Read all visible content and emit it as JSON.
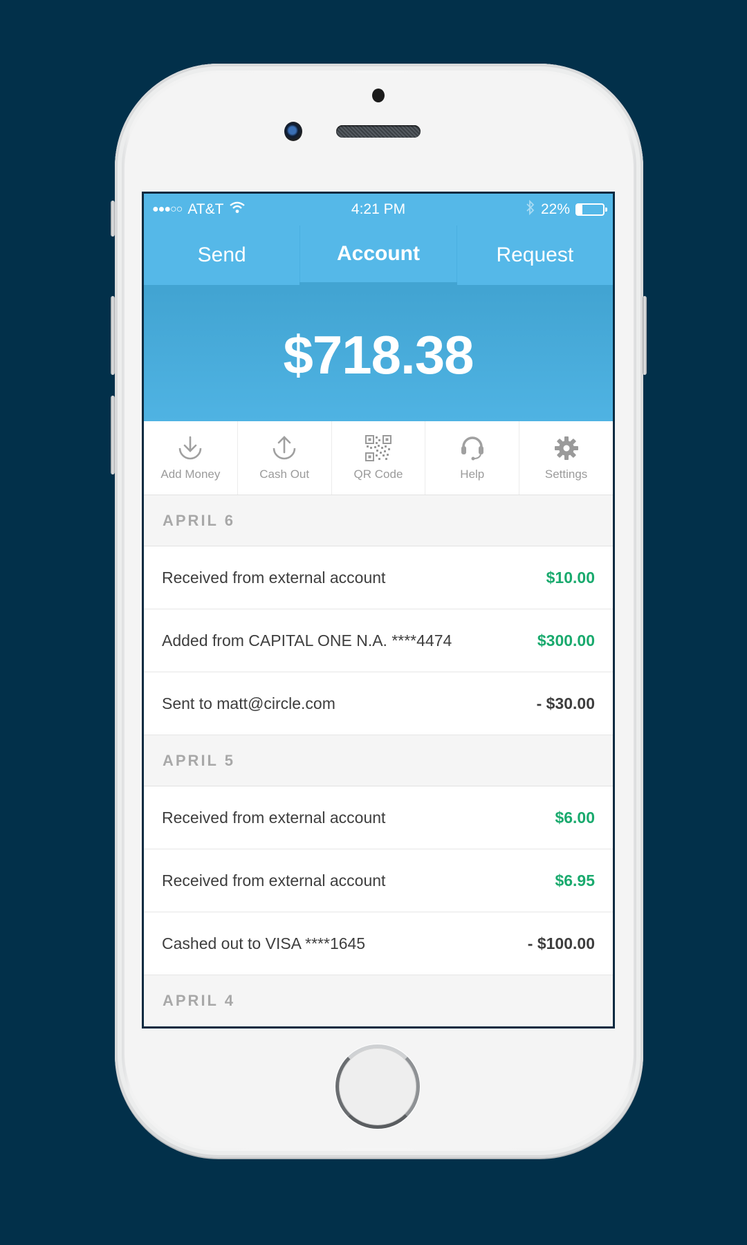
{
  "status_bar": {
    "signal": "●●●○○",
    "carrier": "AT&T",
    "wifi_icon": "wifi-icon",
    "time": "4:21 PM",
    "bluetooth_icon": "bluetooth-icon",
    "battery_percent": "22%",
    "battery_level": 0.22
  },
  "tabs": [
    {
      "label": "Send",
      "active": false
    },
    {
      "label": "Account",
      "active": true
    },
    {
      "label": "Request",
      "active": false
    }
  ],
  "balance": "$718.38",
  "actions": [
    {
      "label": "Add Money",
      "icon": "download-icon"
    },
    {
      "label": "Cash Out",
      "icon": "upload-icon"
    },
    {
      "label": "QR Code",
      "icon": "qr-code-icon"
    },
    {
      "label": "Help",
      "icon": "headset-icon"
    },
    {
      "label": "Settings",
      "icon": "gear-icon"
    }
  ],
  "colors": {
    "primary": "#55b8e8",
    "balance_bg": "#42a4d2",
    "credit": "#1aaa6e",
    "debit": "#3e3e3e",
    "background": "#02304a"
  },
  "groups": [
    {
      "date": "APRIL 6",
      "transactions": [
        {
          "description": "Received from external account",
          "amount": "$10.00",
          "type": "credit"
        },
        {
          "description": "Added from CAPITAL ONE N.A. ****4474",
          "amount": "$300.00",
          "type": "credit"
        },
        {
          "description": "Sent to matt@circle.com",
          "amount": "- $30.00",
          "type": "debit"
        }
      ]
    },
    {
      "date": "APRIL 5",
      "transactions": [
        {
          "description": "Received from external account",
          "amount": "$6.00",
          "type": "credit"
        },
        {
          "description": "Received from external account",
          "amount": "$6.95",
          "type": "credit"
        },
        {
          "description": "Cashed out to VISA ****1645",
          "amount": "- $100.00",
          "type": "debit"
        }
      ]
    },
    {
      "date": "APRIL 4",
      "transactions": []
    }
  ]
}
